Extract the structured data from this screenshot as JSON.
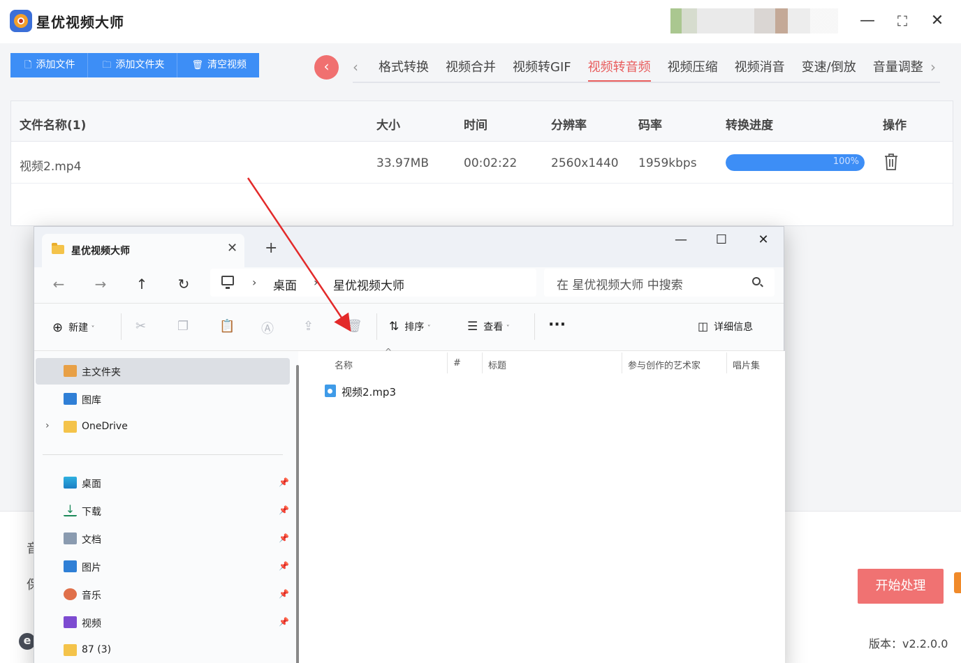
{
  "app": {
    "title": "星优视频大师",
    "toolbar": {
      "add_file": "添加文件",
      "add_folder": "添加文件夹",
      "clear": "清空视频"
    },
    "tabs": [
      {
        "label": "格式转换",
        "active": false
      },
      {
        "label": "视频合并",
        "active": false
      },
      {
        "label": "视频转GIF",
        "active": false
      },
      {
        "label": "视频转音频",
        "active": true
      },
      {
        "label": "视频压缩",
        "active": false
      },
      {
        "label": "视频消音",
        "active": false
      },
      {
        "label": "变速/倒放",
        "active": false
      },
      {
        "label": "音量调整",
        "active": false
      }
    ],
    "table": {
      "headers": {
        "name": "文件名称(1)",
        "size": "大小",
        "time": "时间",
        "resolution": "分辨率",
        "bitrate": "码率",
        "progress": "转换进度",
        "action": "操作"
      },
      "rows": [
        {
          "name": "视频2.mp4",
          "size": "33.97MB",
          "time": "00:02:22",
          "resolution": "2560x1440",
          "bitrate": "1959kbps",
          "progress": 100,
          "progress_label": "100%"
        }
      ]
    },
    "start_button": "开始处理",
    "version": "版本：v2.2.0.0",
    "left_fragments": [
      "音",
      "保"
    ],
    "colors": {
      "accent_blue": "#3d8ef6",
      "accent_red": "#e85c5c",
      "start_red": "#f07272"
    }
  },
  "explorer": {
    "tab_title": "星优视频大师",
    "address": {
      "parts": [
        "桌面",
        "星优视频大师"
      ]
    },
    "search_placeholder": "在 星优视频大师 中搜索",
    "toolbar": {
      "new": "新建",
      "sort": "排序",
      "view": "查看",
      "more": "···",
      "details": "详细信息"
    },
    "sidebar": {
      "top": [
        {
          "label": "主文件夹",
          "icon": "home-icon",
          "selected": true
        },
        {
          "label": "图库",
          "icon": "gallery-icon",
          "selected": false
        },
        {
          "label": "OneDrive",
          "icon": "folder-icon",
          "selected": false
        }
      ],
      "pinned": [
        {
          "label": "桌面",
          "icon": "desktop-icon"
        },
        {
          "label": "下载",
          "icon": "download-icon"
        },
        {
          "label": "文档",
          "icon": "document-icon"
        },
        {
          "label": "图片",
          "icon": "pictures-icon"
        },
        {
          "label": "音乐",
          "icon": "music-icon"
        },
        {
          "label": "视频",
          "icon": "video-icon"
        },
        {
          "label": "87 (3)",
          "icon": "folder-icon"
        }
      ]
    },
    "columns": [
      "名称",
      "#",
      "标题",
      "参与创作的艺术家",
      "唱片集"
    ],
    "files": [
      {
        "name": "视频2.mp3",
        "icon": "audio-file-icon"
      }
    ]
  }
}
